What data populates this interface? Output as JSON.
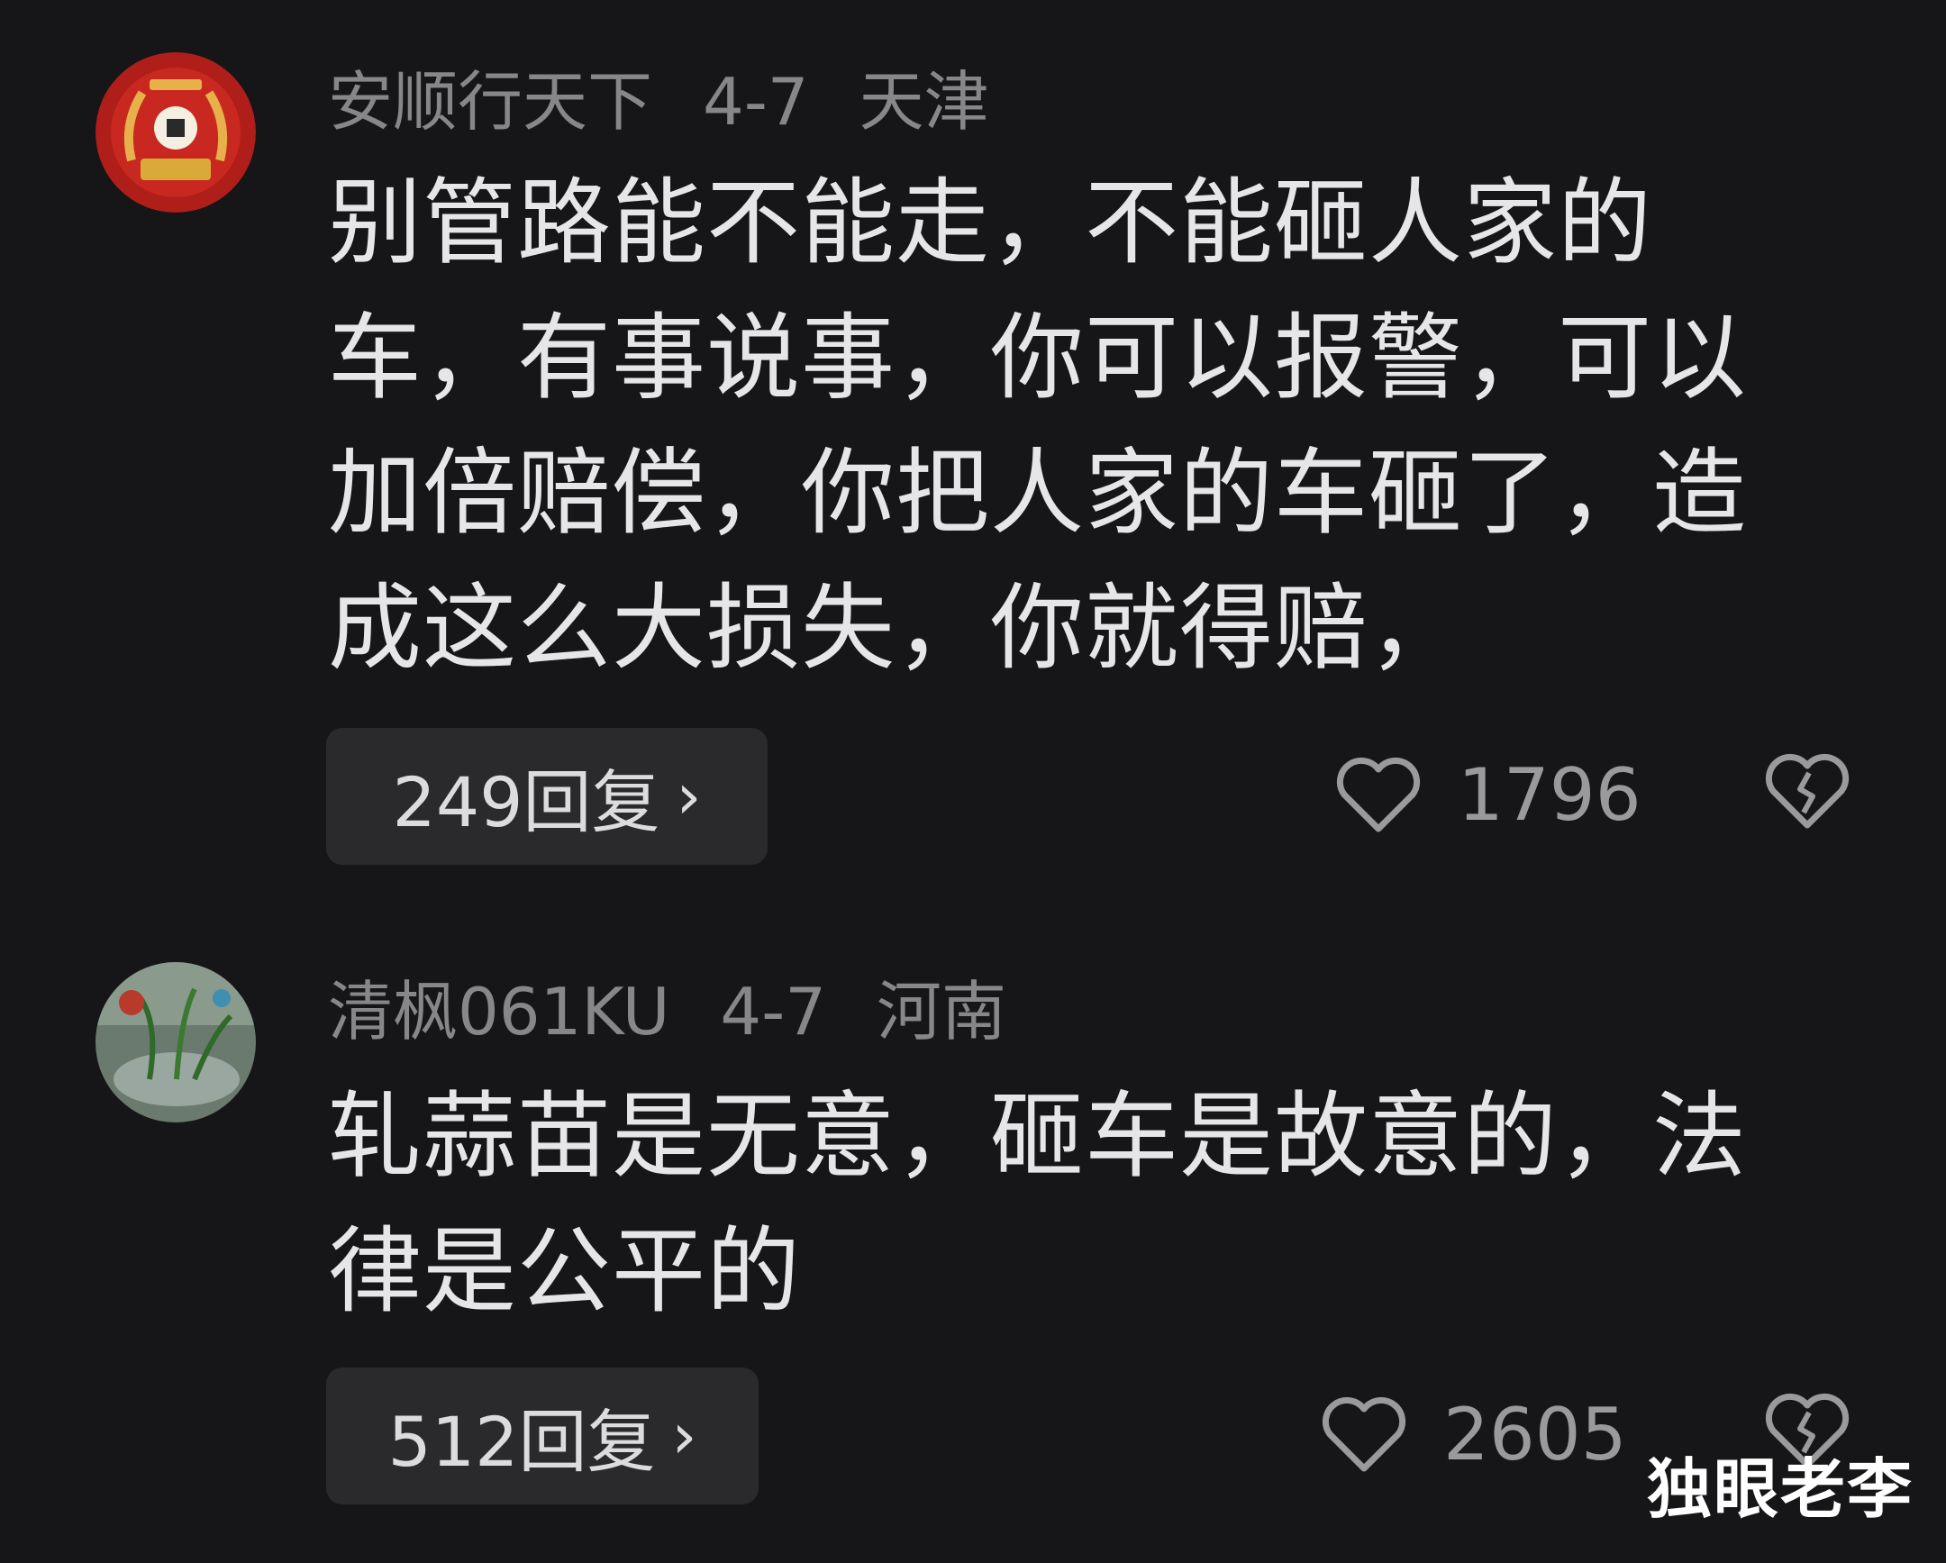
{
  "comments": [
    {
      "username": "安顺行天下",
      "date": "4-7",
      "location": "天津",
      "text": "别管路能不能走，不能砸人家的车，有事说事，你可以报警，可以加倍赔偿，你把人家的车砸了，造成这么大损失，你就得赔，",
      "reply_label": "249回复",
      "likes": "1796",
      "avatar_icon": "gold-laurel-emblem-avatar"
    },
    {
      "username": "清枫061KU",
      "date": "4-7",
      "location": "河南",
      "text": "轧蒜苗是无意，砸车是故意的，法律是公平的",
      "reply_label": "512回复",
      "likes": "2605",
      "avatar_icon": "plant-photo-avatar"
    }
  ],
  "icons": {
    "like": "heart-outline-icon",
    "dislike": "broken-heart-icon",
    "reply_chevron": "chevron-right-icon"
  },
  "watermark": "独眼老李",
  "colors": {
    "background": "#161618",
    "text": "#e6e6e8",
    "meta": "#87878a",
    "button": "#2a2a2d"
  }
}
